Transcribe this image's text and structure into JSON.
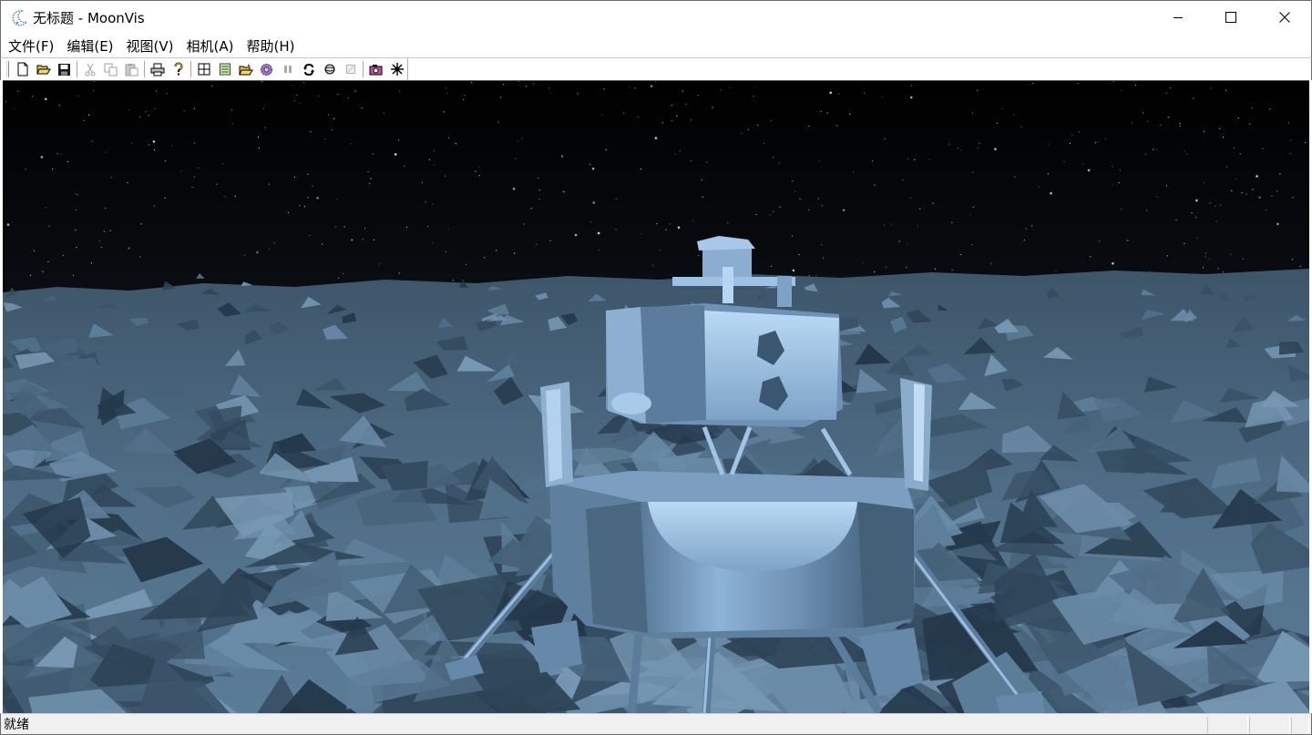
{
  "window": {
    "title": "无标题 - MoonVis",
    "controls": {
      "minimize_icon": "minimize-icon",
      "maximize_icon": "maximize-icon",
      "close_icon": "close-icon"
    }
  },
  "menu": {
    "items": [
      {
        "label": "文件(F)"
      },
      {
        "label": "编辑(E)"
      },
      {
        "label": "视图(V)"
      },
      {
        "label": "相机(A)"
      },
      {
        "label": "帮助(H)"
      }
    ]
  },
  "toolbar": {
    "buttons": [
      {
        "icon": "new-document-icon",
        "enabled": true
      },
      {
        "icon": "open-folder-icon",
        "enabled": true
      },
      {
        "icon": "save-disk-icon",
        "enabled": true
      },
      {
        "icon": "cut-scissors-icon",
        "enabled": false
      },
      {
        "icon": "copy-icon",
        "enabled": false
      },
      {
        "icon": "paste-icon",
        "enabled": false
      },
      {
        "icon": "print-icon",
        "enabled": true
      },
      {
        "icon": "help-question-icon",
        "enabled": true
      },
      {
        "icon": "grid-view-icon",
        "enabled": true
      },
      {
        "icon": "list-panel-icon",
        "enabled": true
      },
      {
        "icon": "open-scene-icon",
        "enabled": true
      },
      {
        "icon": "gear-settings-icon",
        "enabled": true
      },
      {
        "icon": "pause-icon",
        "enabled": false
      },
      {
        "icon": "rotate-arrows-icon",
        "enabled": true
      },
      {
        "icon": "sphere-icon",
        "enabled": true
      },
      {
        "icon": "disabled-square-icon",
        "enabled": false
      },
      {
        "icon": "camera-icon",
        "enabled": true
      },
      {
        "icon": "star-burst-icon",
        "enabled": true
      }
    ]
  },
  "viewport": {
    "scene": "3d-lunar-lander-on-moon-surface",
    "colors": {
      "sky": "#000000",
      "terrain": "#4d6a82",
      "lander_body": "#7a9cbd",
      "highlight": "#a8cdf0"
    }
  },
  "statusbar": {
    "text": "就绪"
  }
}
